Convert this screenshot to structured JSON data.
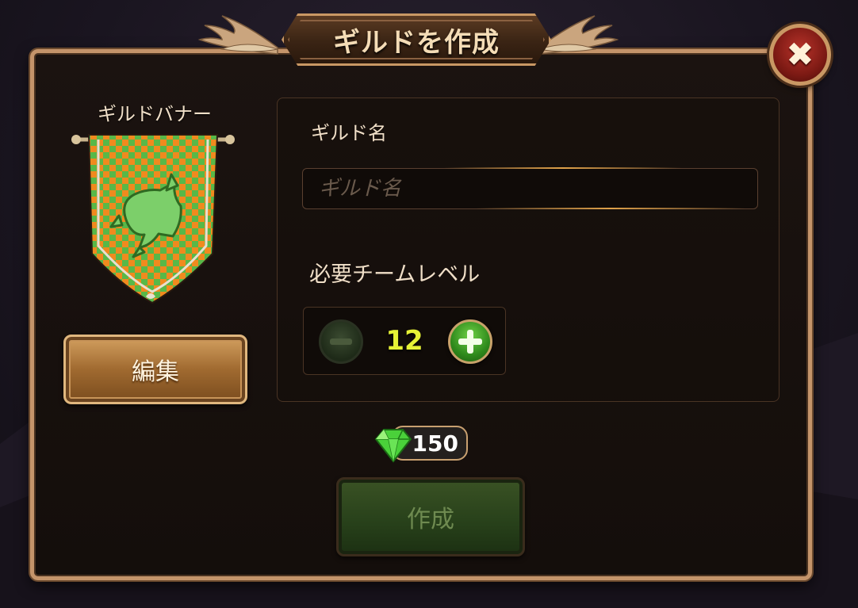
{
  "dialog": {
    "title": "ギルドを作成",
    "close_icon": "close-icon"
  },
  "banner": {
    "label": "ギルドバナー",
    "pattern_colors": [
      "#f08a1e",
      "#58b848"
    ],
    "emblem": "dragon-claw-emblem",
    "edit_button_label": "編集"
  },
  "form": {
    "guild_name_label": "ギルド名",
    "guild_name_value": "",
    "guild_name_placeholder": "ギルド名",
    "required_level_label": "必要チームレベル",
    "required_level_value": "12",
    "minus_icon": "minus-icon",
    "plus_icon": "plus-icon"
  },
  "cost": {
    "currency_icon": "gem-icon",
    "amount": "150"
  },
  "create_button_label": "作成",
  "colors": {
    "frame_gold": "#c4946a",
    "level_value": "#e6f236",
    "close_red": "#b8332a",
    "create_green": "#27401a"
  }
}
